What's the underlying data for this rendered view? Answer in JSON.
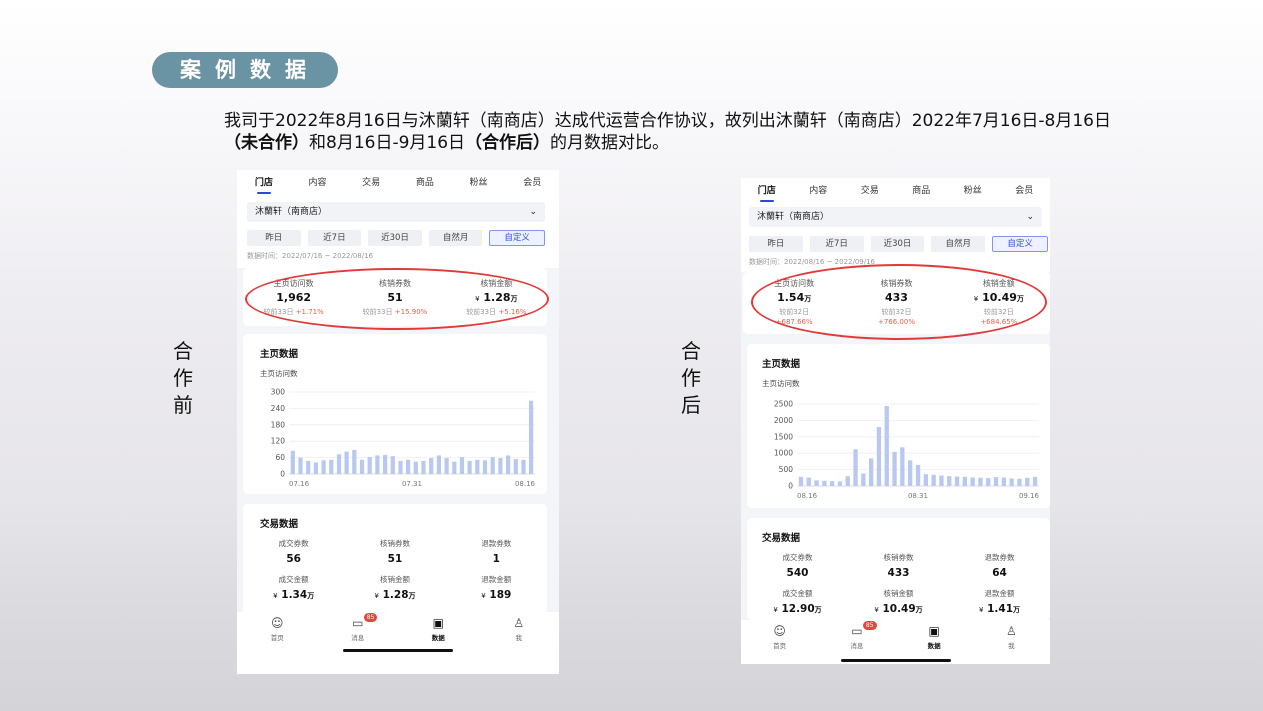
{
  "slide": {
    "badge": "案例数据",
    "desc_plain_1": "我司于2022年8月16日与沐蘭轩（南商店）达成代运营合作协议，故列出沐蘭轩（南商店）2022年7月16日-8月16日",
    "desc_bold_1": "（未合作）",
    "desc_plain_2": "和8月16日-9月16日",
    "desc_bold_2": "（合作后）",
    "desc_plain_3": "的月数据对比。",
    "label_before": [
      "合",
      "作",
      "前"
    ],
    "label_after": [
      "合",
      "作",
      "后"
    ]
  },
  "app": {
    "tabs": [
      "门店",
      "内容",
      "交易",
      "商品",
      "粉丝",
      "会员"
    ],
    "store_name": "沐蘭轩（南商店）",
    "chevron_icon": "chevron-down-icon",
    "ranges": [
      "昨日",
      "近7日",
      "近30日",
      "自然月",
      "自定义"
    ],
    "main_data_title": "主页数据",
    "main_data_sub": "主页访问数",
    "trade_title": "交易数据",
    "nav": [
      {
        "label": "首页",
        "icon": "home-icon"
      },
      {
        "label": "消息",
        "icon": "message-icon",
        "badge": "85"
      },
      {
        "label": "数据",
        "icon": "briefcase-icon"
      },
      {
        "label": "我",
        "icon": "profile-icon"
      }
    ]
  },
  "before": {
    "date_range": "数据时间：2022/07/16 ~ 2022/08/16",
    "metrics": [
      {
        "label": "主页访问数",
        "value": "1,962",
        "unit": "",
        "currency": "",
        "compare": "较前33日",
        "pct": "+1.71%"
      },
      {
        "label": "核销券数",
        "value": "51",
        "unit": "",
        "currency": "",
        "compare": "较前33日",
        "pct": "+15.90%"
      },
      {
        "label": "核销金额",
        "value": "1.28",
        "unit": "万",
        "currency": "¥",
        "compare": "较前33日",
        "pct": "+5.16%"
      }
    ],
    "trade": [
      {
        "label": "成交券数",
        "value": "56",
        "unit": "",
        "currency": ""
      },
      {
        "label": "核销券数",
        "value": "51",
        "unit": "",
        "currency": ""
      },
      {
        "label": "退款券数",
        "value": "1",
        "unit": "",
        "currency": ""
      },
      {
        "label": "成交金额",
        "value": "1.34",
        "unit": "万",
        "currency": "¥"
      },
      {
        "label": "核销金额",
        "value": "1.28",
        "unit": "万",
        "currency": "¥"
      },
      {
        "label": "退款金额",
        "value": "189",
        "unit": "",
        "currency": "¥"
      }
    ]
  },
  "after": {
    "date_range": "数据时间：2022/08/16 ~ 2022/09/16",
    "metrics": [
      {
        "label": "主页访问数",
        "value": "1.54",
        "unit": "万",
        "currency": "",
        "compare": "较前32日",
        "pct": "+687.66%"
      },
      {
        "label": "核销券数",
        "value": "433",
        "unit": "",
        "currency": "",
        "compare": "较前32日",
        "pct": "+766.00%"
      },
      {
        "label": "核销金额",
        "value": "10.49",
        "unit": "万",
        "currency": "¥",
        "compare": "较前32日",
        "pct": "+684.65%"
      }
    ],
    "trade": [
      {
        "label": "成交券数",
        "value": "540",
        "unit": "",
        "currency": ""
      },
      {
        "label": "核销券数",
        "value": "433",
        "unit": "",
        "currency": ""
      },
      {
        "label": "退款券数",
        "value": "64",
        "unit": "",
        "currency": ""
      },
      {
        "label": "成交金额",
        "value": "12.90",
        "unit": "万",
        "currency": "¥"
      },
      {
        "label": "核销金额",
        "value": "10.49",
        "unit": "万",
        "currency": "¥"
      },
      {
        "label": "退款金额",
        "value": "1.41",
        "unit": "万",
        "currency": "¥"
      }
    ]
  },
  "chart_data": [
    {
      "type": "bar",
      "ylabel": "主页访问数",
      "yticks": [
        0,
        60,
        120,
        180,
        240,
        300
      ],
      "ylim": [
        0,
        300
      ],
      "xtick_labels": [
        "07.16",
        "07.31",
        "08.16"
      ],
      "values": [
        85,
        60,
        48,
        42,
        50,
        52,
        72,
        82,
        88,
        52,
        62,
        68,
        70,
        65,
        48,
        52,
        45,
        48,
        58,
        68,
        58,
        45,
        62,
        48,
        52,
        50,
        62,
        58,
        68,
        55,
        52,
        268
      ]
    },
    {
      "type": "bar",
      "ylabel": "主页访问数",
      "yticks": [
        0,
        500,
        1000,
        1500,
        2000,
        2500
      ],
      "ylim": [
        0,
        2500
      ],
      "xtick_labels": [
        "08.16",
        "08.31",
        "09.16"
      ],
      "values": [
        280,
        260,
        170,
        160,
        150,
        140,
        300,
        1120,
        380,
        840,
        1800,
        2440,
        1040,
        1180,
        780,
        640,
        360,
        340,
        320,
        300,
        290,
        280,
        260,
        250,
        240,
        270,
        260,
        230,
        220,
        250,
        280
      ]
    }
  ]
}
